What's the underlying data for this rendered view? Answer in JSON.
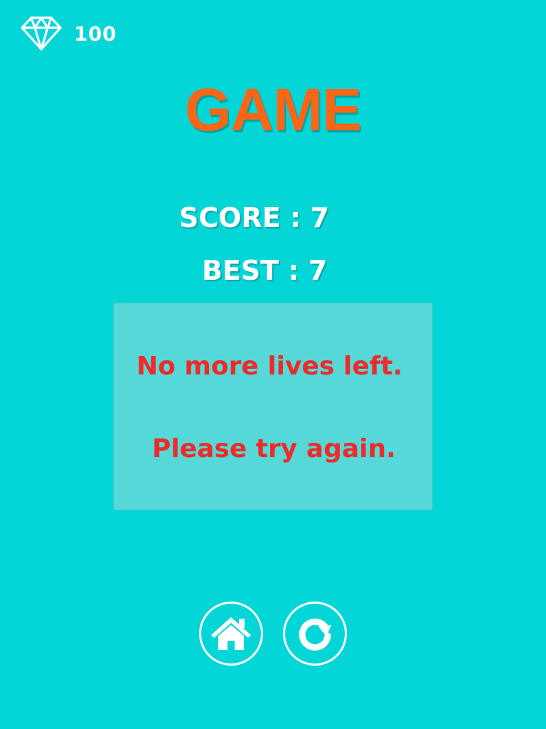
{
  "hud": {
    "gem_icon": "diamond-icon",
    "gem_count": "100"
  },
  "title": "GAME",
  "stats": {
    "score_text": "SCORE : 7",
    "best_text": "BEST : 7"
  },
  "message": {
    "line1": "No more lives left.",
    "line2": "Please try again."
  },
  "buttons": {
    "home_icon": "home-icon",
    "restart_icon": "restart-icon"
  },
  "colors": {
    "background": "#04d6d8",
    "title": "#fa6616",
    "message_text": "#ee2a2a",
    "panel": "#56d8d8",
    "white": "#ffffff"
  }
}
